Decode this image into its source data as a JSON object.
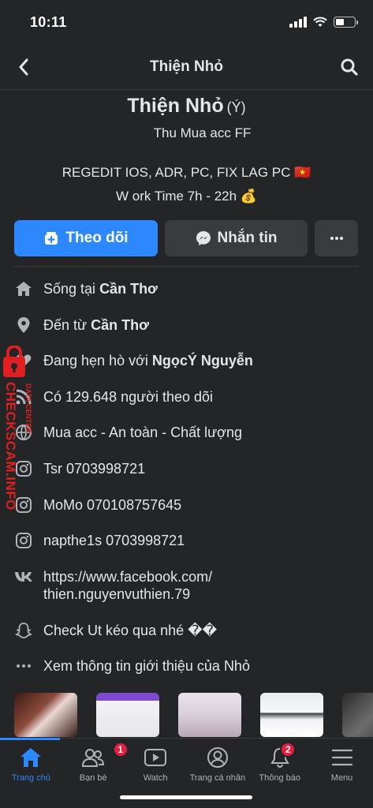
{
  "status_bar": {
    "time": "10:11"
  },
  "nav": {
    "title": "Thiện Nhỏ"
  },
  "profile": {
    "name": "Thiện Nhỏ",
    "alternate_name": "(Ý)",
    "subtitle": "Thu Mua acc FF",
    "bio_line1": "REGEDIT IOS, ADR, PC, FIX LAG PC 🇻🇳",
    "bio_line2": "W ork Time  7h - 22h 💰"
  },
  "actions": {
    "follow_label": "Theo dõi",
    "message_label": "Nhắn tin"
  },
  "info": {
    "lives_prefix": "Sống tại ",
    "lives_value": "Cần Thơ",
    "from_prefix": "Đến từ ",
    "from_value": "Cần Thơ",
    "dating_prefix": "Đang hẹn hò với ",
    "dating_value": "NgọcÝ Nguyễn",
    "followers": "Có 129.648 người theo dõi",
    "tagline": "Mua acc - An toàn - Chất lượng",
    "ig1": "Tsr 0703998721",
    "ig2": "MoMo 070108757645",
    "ig3": "napthe1s 0703998721",
    "vk_line1": "https://www.facebook.com/",
    "vk_line2": "thien.nguyenvuthien.79",
    "snapchat": "Check Ut kéo qua nhé ��",
    "see_more": "Xem thông tin giới thiệu của Nhỏ"
  },
  "watermark": {
    "sub": "DATA CENTER",
    "main": "CHECKSCAM.INFO"
  },
  "tabbar": {
    "home": "Trang chủ",
    "friends": "Bạn bè",
    "friends_badge": "1",
    "watch": "Watch",
    "profile": "Trang cá nhân",
    "notifications": "Thông báo",
    "notifications_badge": "2",
    "menu": "Menu"
  },
  "colors": {
    "accent": "#2d88ff",
    "background": "#242526",
    "badge": "#e41e3f",
    "watermark": "#e02020"
  }
}
